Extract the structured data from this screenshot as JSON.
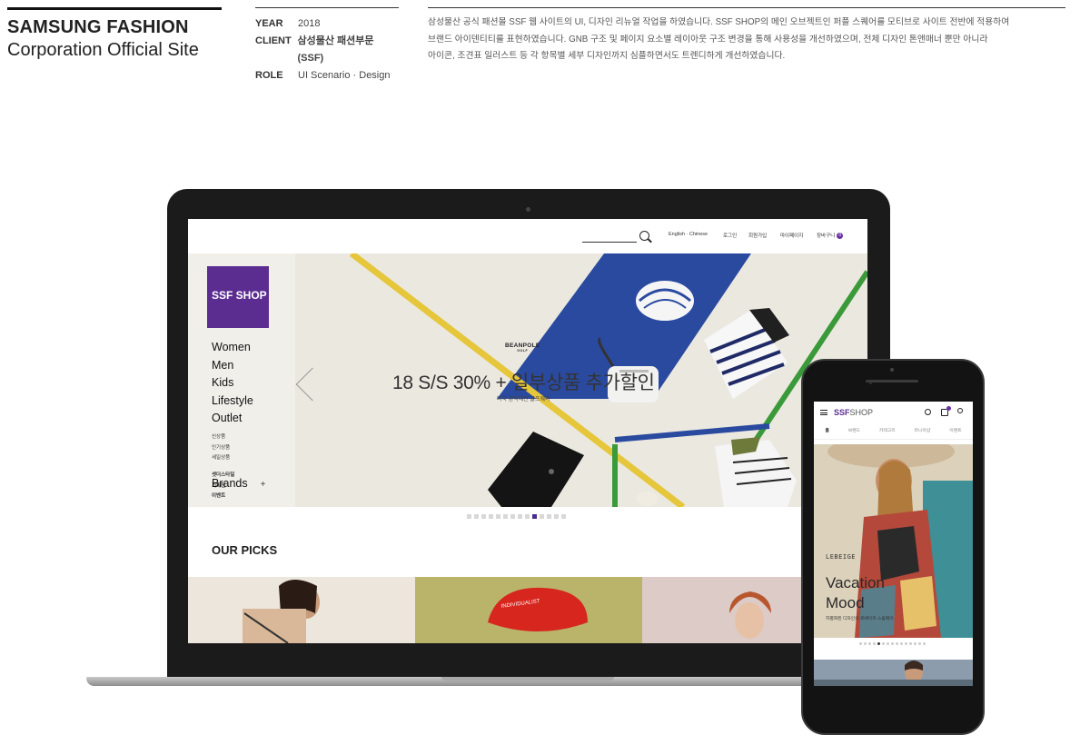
{
  "project": {
    "title_line1": "SAMSUNG FASHION",
    "title_line2": "Corporation Official Site",
    "meta": [
      {
        "key": "YEAR",
        "value": "2018"
      },
      {
        "key": "CLIENT",
        "value": "삼성물산 패션부문(SSF)"
      },
      {
        "key": "ROLE",
        "value": "UI Scenario · Design"
      }
    ],
    "description": "삼성물산 공식 패션몰 SSF 웹 사이트의 UI, 디자인 리뉴얼 작업을 하였습니다. SSF SHOP의 메인 오브젝트인 퍼플 스퀘어를 모티브로 사이트 전반에 적용하여\n브랜드 아이덴티티를 표현하였습니다. GNB 구조 및 페이지 요소별 레이아웃 구조 변경을 통해 사용성을 개선하였으며, 전체 디자인 톤앤매너 뿐만 아니라\n아이콘, 조견표 일러스트 등 각 항목별 세부 디자인까지 심플하면서도 트렌디하게 개선하였습니다."
  },
  "desktop": {
    "logo": "SSF SHOP",
    "utility": {
      "lang": "English · Chinese",
      "login": "로그인",
      "join": "회원가입",
      "mypage": "마이페이지",
      "cart": "장바구니",
      "cart_count": "0"
    },
    "nav_main": [
      "Women",
      "Men",
      "Kids",
      "Lifestyle",
      "Outlet"
    ],
    "nav_sub1": [
      "신상품",
      "인기상품",
      "세일상품"
    ],
    "nav_sub2": [
      "셋더스타일",
      "기획전",
      "이벤트"
    ],
    "nav_brands": "Brands",
    "nav_brands_plus": "+",
    "hero_brand": "BEANPOLE",
    "hero_brand_sub": "GOLF",
    "hero_headline": "18 S/S 30% + 일부상품 추가할인",
    "hero_subline": "더욱 완벽해진 골프웨어",
    "slider": {
      "total": 14,
      "active_index": 9
    },
    "section_title": "OUR PICKS"
  },
  "mobile": {
    "logo": "SSF",
    "logo_rest": "SHOP",
    "tabs": [
      "홈",
      "브랜드",
      "카테고리",
      "마니아샵",
      "이벤트"
    ],
    "hero_brand": "LEBEIGE",
    "hero_title": "Vacation\nMood",
    "hero_sub": "차별화된 디자인의 르베이지 스윔웨어",
    "slider": {
      "total": 15,
      "active_index": 4
    }
  },
  "colors": {
    "brand_purple": "#5b2d91",
    "accent_yellow": "#e6c63a",
    "accent_blue": "#2a4aa0",
    "accent_green": "#3a9a3a"
  }
}
